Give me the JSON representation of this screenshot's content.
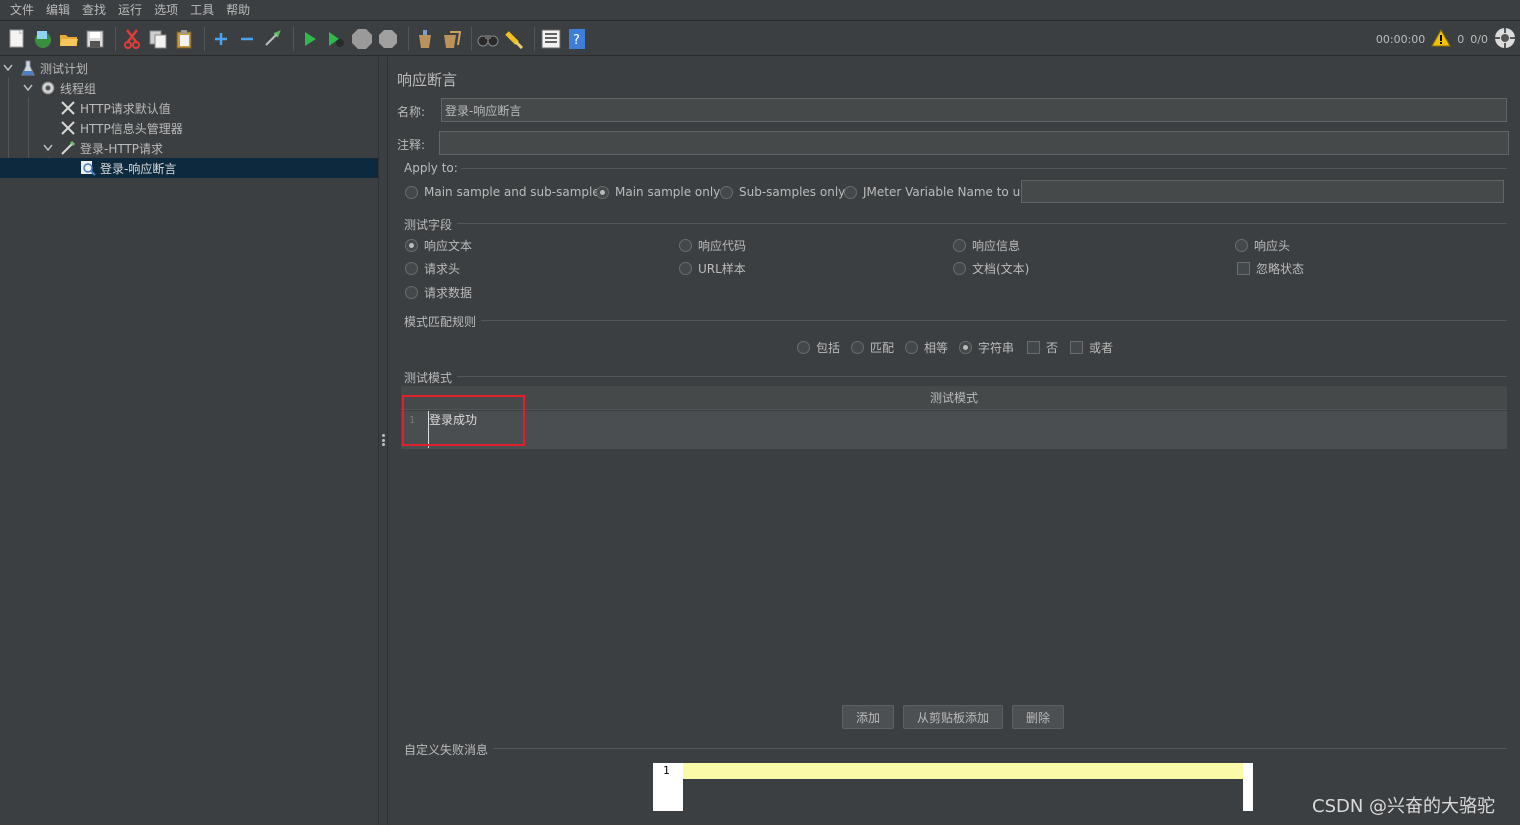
{
  "menu": [
    "文件",
    "编辑",
    "查找",
    "运行",
    "选项",
    "工具",
    "帮助"
  ],
  "toolbar": {
    "icons": [
      "new-icon",
      "templates-icon",
      "open-icon",
      "save-icon",
      "cut-icon",
      "copy-icon",
      "paste-icon",
      "expand-icon",
      "collapse-icon",
      "toggle-icon",
      "start-icon",
      "start-no-pause-icon",
      "stop-icon",
      "shutdown-icon",
      "clear-icon",
      "clear-all-icon",
      "search-icon",
      "reset-search-icon",
      "function-helper-icon",
      "help-icon"
    ],
    "timer": "00:00:00",
    "warning_count": "0",
    "threads": "0/0"
  },
  "tree": {
    "items": [
      {
        "label": "测试计划",
        "icon": "test-plan-icon"
      },
      {
        "label": "线程组",
        "icon": "gear-icon"
      },
      {
        "label": "HTTP请求默认值",
        "icon": "config-element-icon"
      },
      {
        "label": "HTTP信息头管理器",
        "icon": "config-element-icon"
      },
      {
        "label": "登录-HTTP请求",
        "icon": "sampler-icon"
      },
      {
        "label": "登录-响应断言",
        "icon": "assertion-icon"
      }
    ]
  },
  "panel": {
    "title": "响应断言",
    "name_label": "名称:",
    "name_value": "登录-响应断言",
    "comment_label": "注释:",
    "comment_value": "",
    "apply_to": {
      "label": "Apply to:",
      "options": [
        "Main sample and sub-samples",
        "Main sample only",
        "Sub-samples only",
        "JMeter Variable Name to use"
      ],
      "selected": "Main sample only",
      "variable_value": ""
    },
    "test_field": {
      "label": "测试字段",
      "options": [
        "响应文本",
        "响应代码",
        "响应信息",
        "响应头",
        "请求头",
        "URL样本",
        "文档(文本)",
        "忽略状态",
        "请求数据"
      ],
      "selected": "响应文本"
    },
    "pattern_rules": {
      "label": "模式匹配规则",
      "options": [
        "包括",
        "匹配",
        "相等",
        "字符串",
        "否",
        "或者"
      ],
      "selected": "字符串"
    },
    "patterns": {
      "label": "测试模式",
      "column_header": "测试模式",
      "rows": [
        {
          "line": "1",
          "value": "登录成功"
        }
      ]
    },
    "buttons": {
      "add": "添加",
      "add_from_clipboard": "从剪贴板添加",
      "delete": "删除"
    },
    "custom_message": {
      "label": "自定义失败消息",
      "line": "1",
      "value": ""
    }
  },
  "watermark": "CSDN @兴奋的大骆驼",
  "colors": {
    "background": "#3c3f41",
    "selection": "#0d293e",
    "highlight_box": "#e0202a",
    "editor_line": "#fafaa8"
  }
}
